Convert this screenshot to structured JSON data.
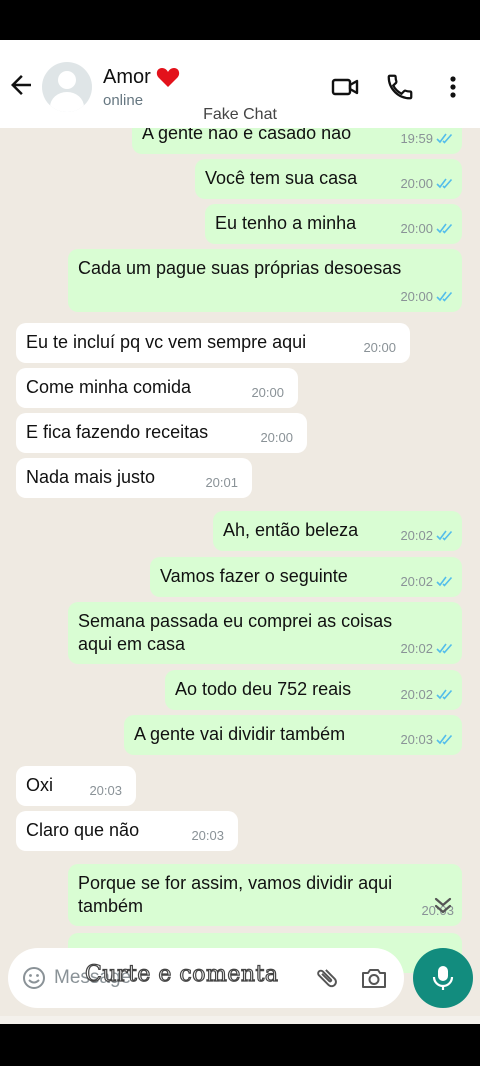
{
  "header": {
    "contact_name": "Amor",
    "status": "online",
    "overlay_label": "Fake Chat"
  },
  "messages": [
    {
      "dir": "out",
      "text": "A gente não é casado não",
      "time": "19:59"
    },
    {
      "dir": "out",
      "text": "Você tem sua casa",
      "time": "20:00"
    },
    {
      "dir": "out",
      "text": "Eu tenho a minha",
      "time": "20:00"
    },
    {
      "dir": "out",
      "text": "Cada um pague suas próprias desoesas",
      "time": "20:00"
    },
    {
      "dir": "in",
      "text": "Eu te incluí pq vc vem sempre aqui",
      "time": "20:00"
    },
    {
      "dir": "in",
      "text": "Come minha comida",
      "time": "20:00"
    },
    {
      "dir": "in",
      "text": "E fica fazendo receitas",
      "time": "20:00"
    },
    {
      "dir": "in",
      "text": "Nada mais justo",
      "time": "20:01"
    },
    {
      "dir": "out",
      "text": "Ah, então beleza",
      "time": "20:02"
    },
    {
      "dir": "out",
      "text": "Vamos fazer o seguinte",
      "time": "20:02"
    },
    {
      "dir": "out",
      "text": "Semana passada eu comprei as coisas\naqui em casa",
      "time": "20:02"
    },
    {
      "dir": "out",
      "text": "Ao todo deu 752 reais",
      "time": "20:02"
    },
    {
      "dir": "out",
      "text": "A gente vai dividir também",
      "time": "20:03"
    },
    {
      "dir": "in",
      "text": "Oxi",
      "time": "20:03"
    },
    {
      "dir": "in",
      "text": "Claro que não",
      "time": "20:03"
    },
    {
      "dir": "out",
      "text": "Porque se for assim, vamos dividir aqui\ntambém",
      "time": "20:03"
    }
  ],
  "composer": {
    "placeholder": "Message",
    "overlay_caption": "Curte e comenta"
  },
  "colors": {
    "outgoing_bubble": "#d9fdd3",
    "incoming_bubble": "#ffffff",
    "chat_background": "#efeae2",
    "read_tick": "#53bdeb",
    "mic_button": "#128c7e"
  }
}
